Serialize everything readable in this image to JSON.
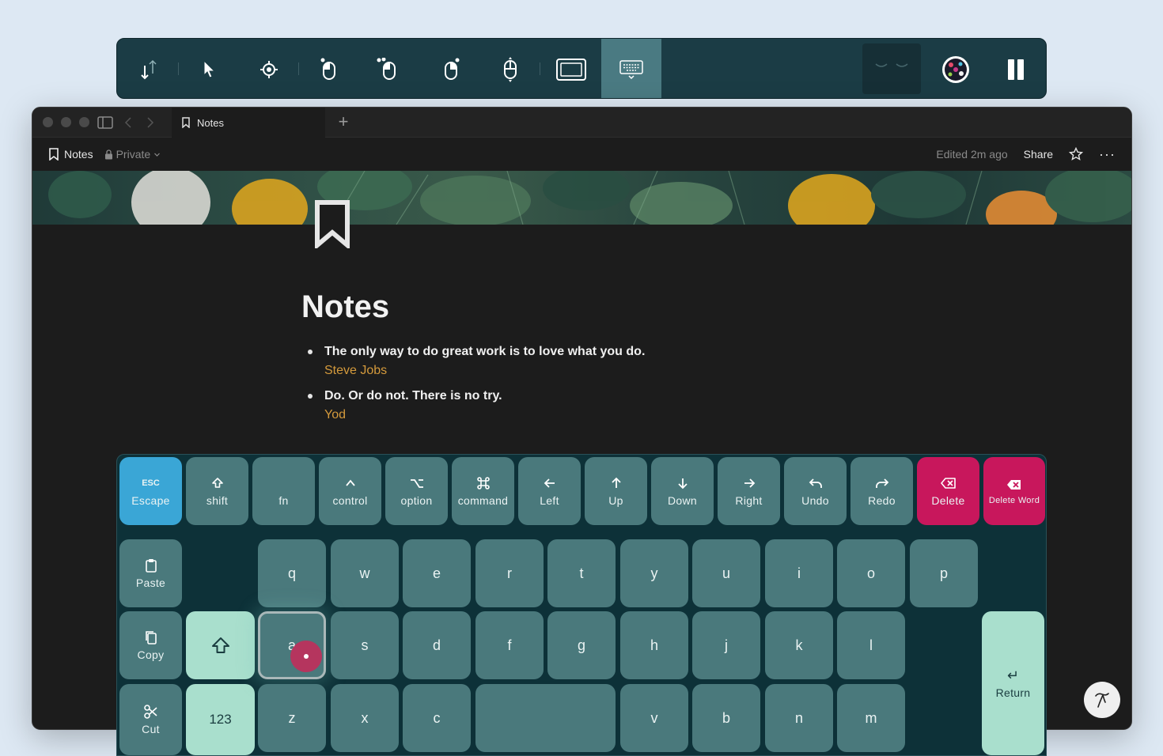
{
  "toolbar": {
    "buttons": [
      {
        "name": "scroll-direction-icon"
      },
      {
        "name": "pointer-icon"
      },
      {
        "name": "target-icon"
      },
      {
        "name": "left-click-icon"
      },
      {
        "name": "double-click-icon"
      },
      {
        "name": "right-click-icon"
      },
      {
        "name": "middle-click-icon"
      },
      {
        "name": "window-icon"
      },
      {
        "name": "keyboard-icon",
        "active": true
      },
      {
        "name": "eyes-closed-icon"
      },
      {
        "name": "avatar"
      },
      {
        "name": "pause-icon"
      }
    ],
    "active_color": "#4a7a82",
    "background": "#1b3c45"
  },
  "window": {
    "tab_label": "Notes",
    "new_tab_symbol": "+",
    "breadcrumb": "Notes",
    "privacy": "Private",
    "edited": "Edited 2m ago",
    "share_label": "Share",
    "more_symbol": "···"
  },
  "page": {
    "title": "Notes",
    "quotes": [
      {
        "text": "The only way to do great work is to love what you do.",
        "author": "Steve Jobs"
      },
      {
        "text": "Do. Or do not. There is no try.",
        "author": "Yod"
      }
    ],
    "author_color": "#d49a3c"
  },
  "keyboard": {
    "row1": [
      {
        "label": "Escape",
        "icon": "ESC"
      },
      {
        "label": "shift",
        "icon": "shift-icon"
      },
      {
        "label": "fn",
        "icon": ""
      },
      {
        "label": "control",
        "icon": "control-icon"
      },
      {
        "label": "option",
        "icon": "option-icon"
      },
      {
        "label": "command",
        "icon": "command-icon"
      },
      {
        "label": "Left",
        "icon": "arrow-left-icon"
      },
      {
        "label": "Up",
        "icon": "arrow-up-icon"
      },
      {
        "label": "Down",
        "icon": "arrow-down-icon"
      },
      {
        "label": "Right",
        "icon": "arrow-right-icon"
      },
      {
        "label": "Undo",
        "icon": "undo-icon"
      },
      {
        "label": "Redo",
        "icon": "redo-icon"
      },
      {
        "label": "Delete",
        "icon": "delete-icon"
      },
      {
        "label": "Delete Word",
        "icon": "delete-word-icon"
      }
    ],
    "side": {
      "paste": "Paste",
      "copy": "Copy",
      "cut": "Cut",
      "numbers": "123",
      "return": "Return",
      "return_symbol": "↵"
    },
    "letters_row1": [
      "q",
      "w",
      "e",
      "r",
      "t",
      "y",
      "u",
      "i",
      "o",
      "p"
    ],
    "letters_row2": [
      "a",
      "s",
      "d",
      "f",
      "g",
      "h",
      "j",
      "k",
      "l"
    ],
    "letters_row3": [
      "z",
      "x",
      "c",
      "v",
      "b",
      "n",
      "m"
    ],
    "selected_key": "a",
    "colors": {
      "key": "#4a797c",
      "escape": "#3aa6d6",
      "delete": "#c8175c",
      "mint": "#a9dfcd",
      "background": "#0d3138"
    }
  }
}
